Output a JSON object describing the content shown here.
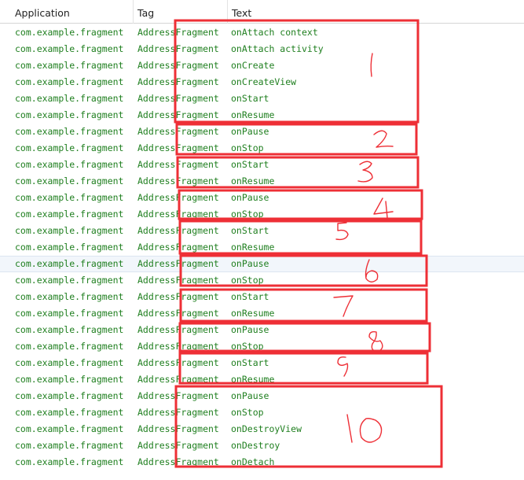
{
  "columns": {
    "application": "Application",
    "tag": "Tag",
    "text": "Text"
  },
  "rows": [
    {
      "app": "com.example.fragment",
      "tag": "AddressFragment",
      "text": "onAttach context"
    },
    {
      "app": "com.example.fragment",
      "tag": "AddressFragment",
      "text": "onAttach activity"
    },
    {
      "app": "com.example.fragment",
      "tag": "AddressFragment",
      "text": "onCreate"
    },
    {
      "app": "com.example.fragment",
      "tag": "AddressFragment",
      "text": "onCreateView"
    },
    {
      "app": "com.example.fragment",
      "tag": "AddressFragment",
      "text": "onStart"
    },
    {
      "app": "com.example.fragment",
      "tag": "AddressFragment",
      "text": "onResume"
    },
    {
      "app": "com.example.fragment",
      "tag": "AddressFragment",
      "text": "onPause"
    },
    {
      "app": "com.example.fragment",
      "tag": "AddressFragment",
      "text": "onStop"
    },
    {
      "app": "com.example.fragment",
      "tag": "AddressFragment",
      "text": "onStart"
    },
    {
      "app": "com.example.fragment",
      "tag": "AddressFragment",
      "text": "onResume"
    },
    {
      "app": "com.example.fragment",
      "tag": "AddressFragment",
      "text": "onPause"
    },
    {
      "app": "com.example.fragment",
      "tag": "AddressFragment",
      "text": "onStop"
    },
    {
      "app": "com.example.fragment",
      "tag": "AddressFragment",
      "text": "onStart"
    },
    {
      "app": "com.example.fragment",
      "tag": "AddressFragment",
      "text": "onResume"
    },
    {
      "app": "com.example.fragment",
      "tag": "AddressFragment",
      "text": "onPause"
    },
    {
      "app": "com.example.fragment",
      "tag": "AddressFragment",
      "text": "onStop"
    },
    {
      "app": "com.example.fragment",
      "tag": "AddressFragment",
      "text": "onStart"
    },
    {
      "app": "com.example.fragment",
      "tag": "AddressFragment",
      "text": "onResume"
    },
    {
      "app": "com.example.fragment",
      "tag": "AddressFragment",
      "text": "onPause"
    },
    {
      "app": "com.example.fragment",
      "tag": "AddressFragment",
      "text": "onStop"
    },
    {
      "app": "com.example.fragment",
      "tag": "AddressFragment",
      "text": "onStart"
    },
    {
      "app": "com.example.fragment",
      "tag": "AddressFragment",
      "text": "onResume"
    },
    {
      "app": "com.example.fragment",
      "tag": "AddressFragment",
      "text": "onPause"
    },
    {
      "app": "com.example.fragment",
      "tag": "AddressFragment",
      "text": "onStop"
    },
    {
      "app": "com.example.fragment",
      "tag": "AddressFragment",
      "text": "onDestroyView"
    },
    {
      "app": "com.example.fragment",
      "tag": "AddressFragment",
      "text": "onDestroy"
    },
    {
      "app": "com.example.fragment",
      "tag": "AddressFragment",
      "text": "onDetach"
    }
  ],
  "selected_row": 14,
  "colors": {
    "log_text": "#1f7f1f",
    "annotation": "#ee2f36"
  },
  "annotations": [
    "1",
    "2",
    "3",
    "4",
    "5",
    "6",
    "7",
    "8",
    "9",
    "10"
  ]
}
